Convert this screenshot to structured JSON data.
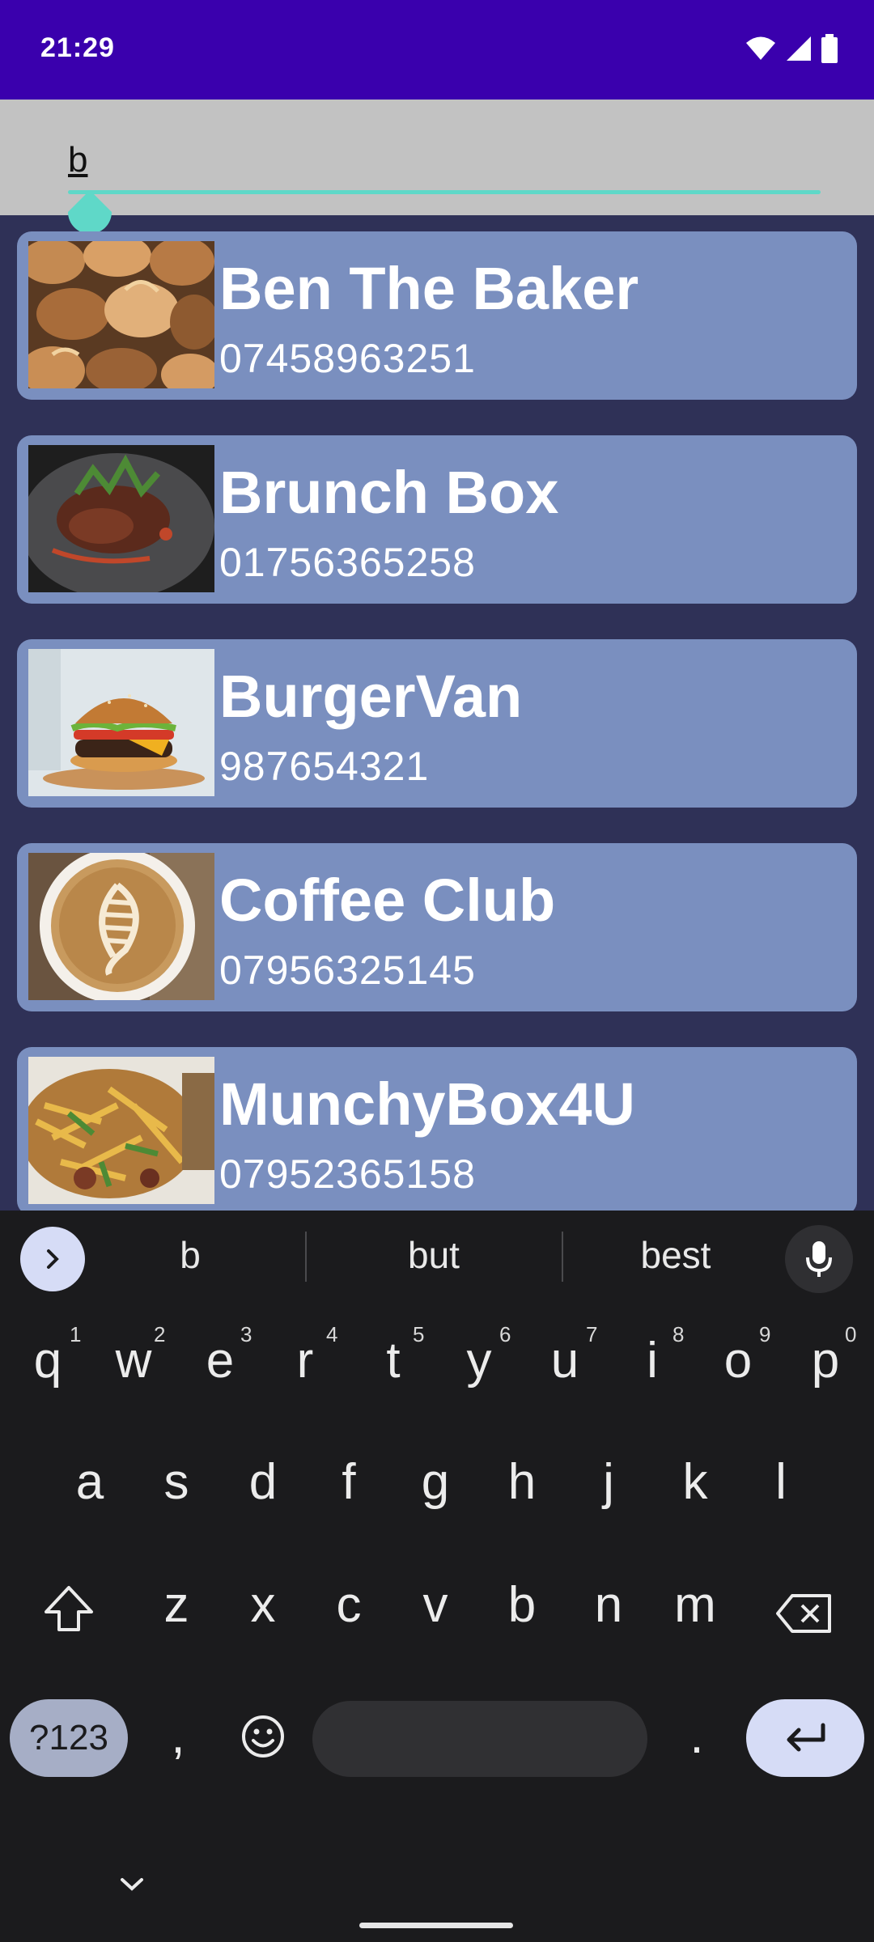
{
  "status_bar": {
    "time": "21:29",
    "icons": [
      "wifi-icon",
      "signal-icon",
      "battery-icon"
    ]
  },
  "search": {
    "value": "b"
  },
  "list": [
    {
      "name": "Ben The Baker",
      "phone": "07458963251",
      "image": "bread-photo"
    },
    {
      "name": "Brunch Box",
      "phone": "01756365258",
      "image": "steak-plate-photo"
    },
    {
      "name": "BurgerVan",
      "phone": "987654321",
      "image": "burger-photo"
    },
    {
      "name": "Coffee Club",
      "phone": "07956325145",
      "image": "latte-photo"
    },
    {
      "name": "MunchyBox4U",
      "phone": "07952365158",
      "image": "fries-box-photo"
    }
  ],
  "keyboard": {
    "suggestions": [
      "b",
      "but",
      "best"
    ],
    "row1": [
      "q",
      "w",
      "e",
      "r",
      "t",
      "y",
      "u",
      "i",
      "o",
      "p"
    ],
    "row1_hints": [
      "1",
      "2",
      "3",
      "4",
      "5",
      "6",
      "7",
      "8",
      "9",
      "0"
    ],
    "row2": [
      "a",
      "s",
      "d",
      "f",
      "g",
      "h",
      "j",
      "k",
      "l"
    ],
    "row3": [
      "z",
      "x",
      "c",
      "v",
      "b",
      "n",
      "m"
    ],
    "symbols_label": "?123",
    "comma": ",",
    "period": "."
  },
  "colors": {
    "status_bar": "#3a00ad",
    "search_bg": "#c2c2c2",
    "accent": "#5fd8c8",
    "card_bg": "#7a8fbf",
    "list_bg": "#2f3157",
    "keyboard_bg": "#1b1b1d"
  }
}
